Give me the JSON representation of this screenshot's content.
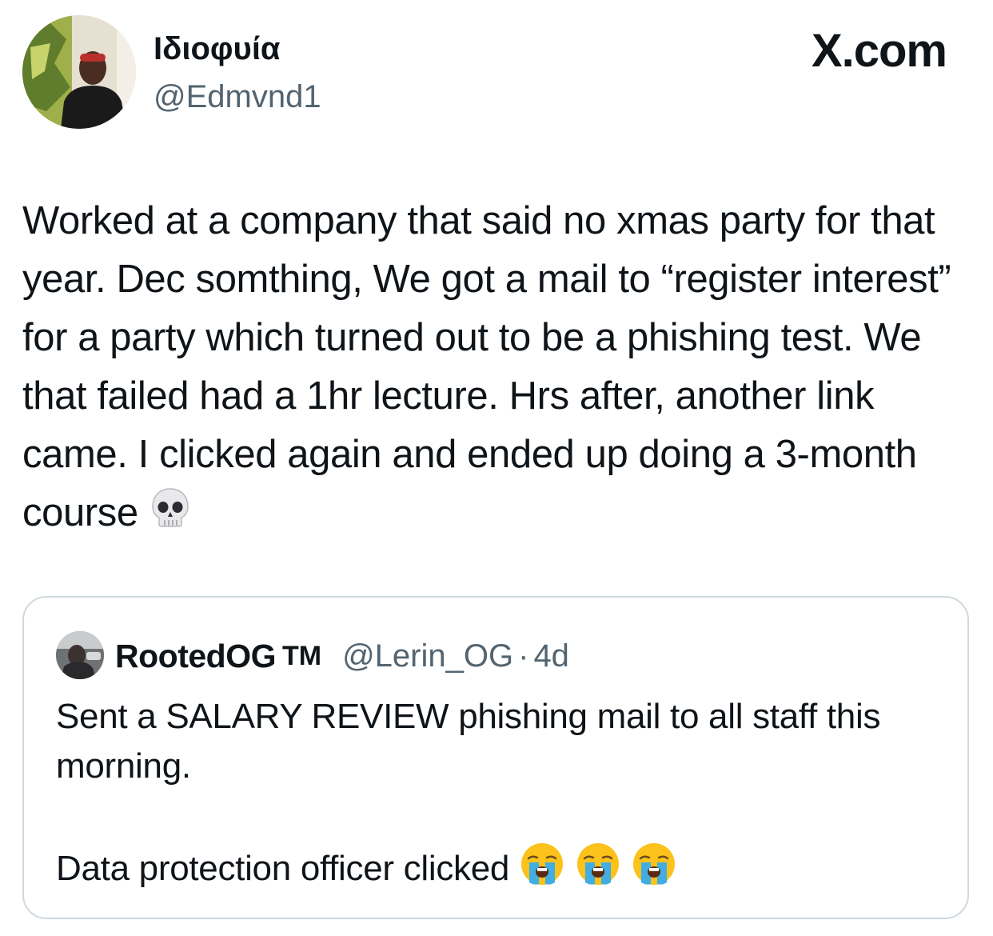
{
  "author": {
    "display_name": "Ιδιοφυία",
    "handle": "@Edmvnd1"
  },
  "brand": {
    "label": "X.com"
  },
  "tweet": {
    "text": "Worked at a company that said no xmas party for that year. Dec somthing, We got a mail to “register interest” for a party which turned out to be a phishing test. We that failed had a 1hr lecture. Hrs after, another link came. I clicked again and ended up doing a 3-month course",
    "emoji_icon": "skull-emoji-icon"
  },
  "quoted_tweet": {
    "display_name": "RootedOG",
    "name_suffix": "TM",
    "handle": "@Lerin_OG",
    "separator": "·",
    "time": "4d",
    "text_line1": "Sent a SALARY REVIEW phishing mail to all staff this morning.",
    "text_line2": "Data protection officer clicked",
    "emoji_icons": [
      "loudly-crying-face-icon",
      "loudly-crying-face-icon",
      "loudly-crying-face-icon"
    ]
  },
  "colors": {
    "text_primary": "#0f1419",
    "text_secondary": "#536471",
    "border": "#cfd9de"
  }
}
